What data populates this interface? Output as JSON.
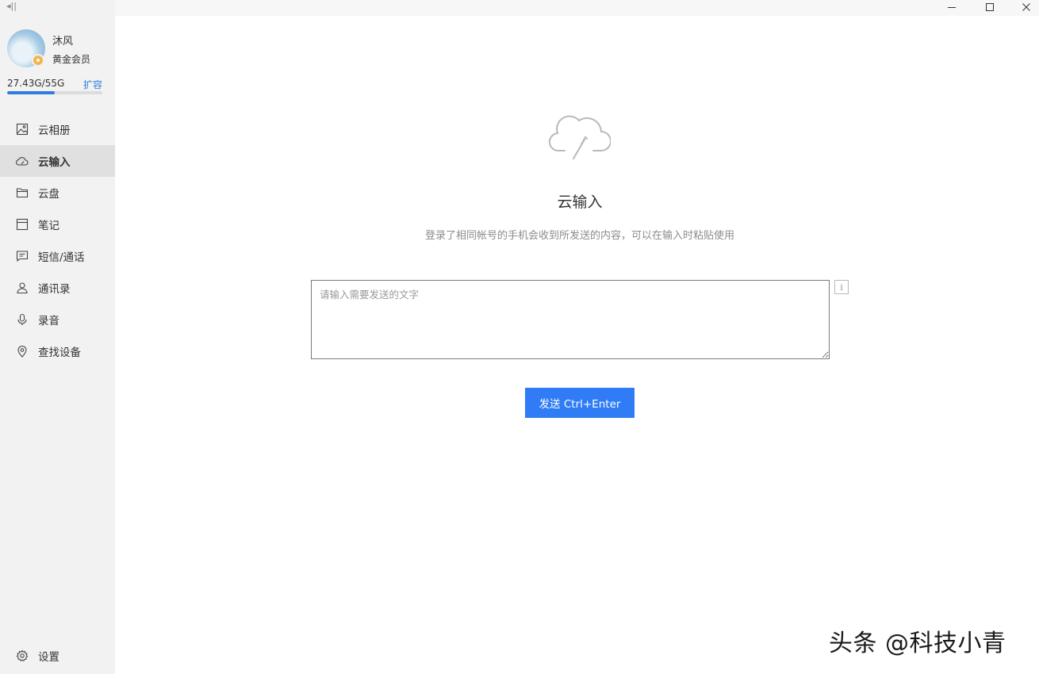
{
  "user": {
    "name": "沐风",
    "level": "黄金会员",
    "storage_text": "27.43G/55G",
    "storage_used_fraction": 0.5,
    "expand_label": "扩容"
  },
  "sidebar": {
    "items": [
      {
        "label": "云相册",
        "icon": "image-icon",
        "active": false
      },
      {
        "label": "云输入",
        "icon": "cloud-input-icon",
        "active": true
      },
      {
        "label": "云盘",
        "icon": "folder-icon",
        "active": false
      },
      {
        "label": "笔记",
        "icon": "notebook-icon",
        "active": false
      },
      {
        "label": "短信/通话",
        "icon": "message-icon",
        "active": false
      },
      {
        "label": "通讯录",
        "icon": "contact-icon",
        "active": false
      },
      {
        "label": "录音",
        "icon": "microphone-icon",
        "active": false
      },
      {
        "label": "查找设备",
        "icon": "location-pin-icon",
        "active": false
      }
    ],
    "settings_label": "设置"
  },
  "main": {
    "title": "云输入",
    "description": "登录了相同帐号的手机会收到所发送的内容，可以在输入时粘贴使用",
    "input_placeholder": "请输入需要发送的文字",
    "input_value": "",
    "info_glyph": "i",
    "send_label": "发送 Ctrl+Enter"
  },
  "watermark": "头条 @科技小青",
  "colors": {
    "accent": "#2f7cf6",
    "sidebar_bg": "#f2f2f2",
    "active_item_bg": "#e0e0e0",
    "link": "#2f7de1"
  }
}
